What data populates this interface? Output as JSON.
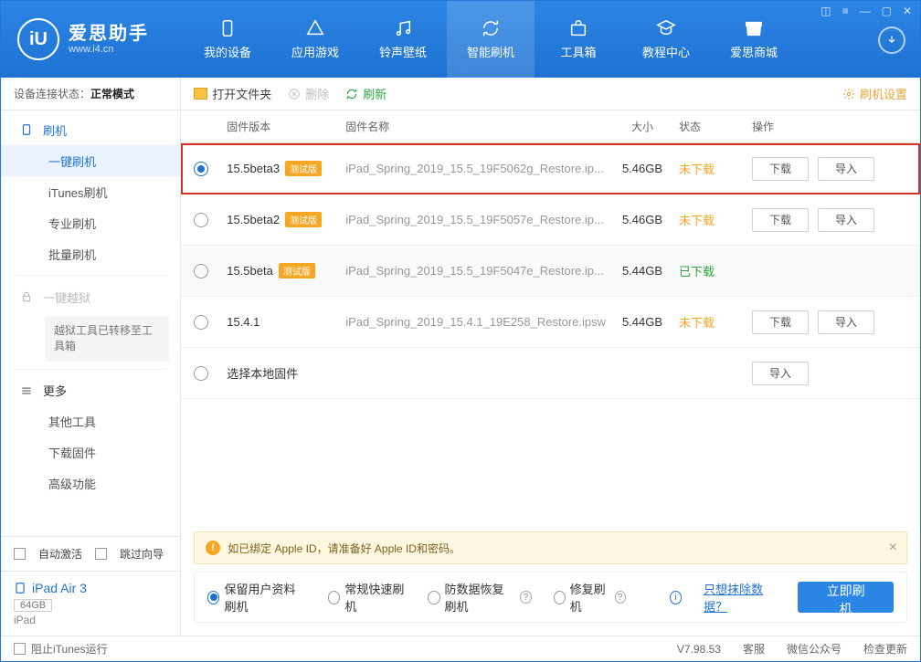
{
  "app": {
    "name": "爱思助手",
    "url": "www.i4.cn"
  },
  "nav": {
    "items": [
      {
        "id": "device",
        "label": "我的设备"
      },
      {
        "id": "apps",
        "label": "应用游戏"
      },
      {
        "id": "ring",
        "label": "铃声壁纸"
      },
      {
        "id": "flash",
        "label": "智能刷机"
      },
      {
        "id": "tools",
        "label": "工具箱"
      },
      {
        "id": "tutorial",
        "label": "教程中心"
      },
      {
        "id": "store",
        "label": "爱思商城"
      }
    ],
    "active": 3
  },
  "connection": {
    "label": "设备连接状态：",
    "value": "正常模式"
  },
  "sidebar": {
    "flash": {
      "label": "刷机",
      "children": [
        {
          "id": "oneclick",
          "label": "一键刷机"
        },
        {
          "id": "itunes",
          "label": "iTunes刷机"
        },
        {
          "id": "pro",
          "label": "专业刷机"
        },
        {
          "id": "batch",
          "label": "批量刷机"
        }
      ]
    },
    "jailbreak": {
      "label": "一键越狱",
      "note": "越狱工具已转移至工具箱"
    },
    "more": {
      "label": "更多",
      "children": [
        {
          "id": "othertools",
          "label": "其他工具"
        },
        {
          "id": "downloadfw",
          "label": "下载固件"
        },
        {
          "id": "advanced",
          "label": "高级功能"
        }
      ]
    }
  },
  "sideFooter": {
    "autoActivate": "自动激活",
    "skipGuide": "跳过向导"
  },
  "device": {
    "name": "iPad Air 3",
    "capacity": "64GB",
    "type": "iPad"
  },
  "toolbar": {
    "open": "打开文件夹",
    "delete": "删除",
    "refresh": "刷新",
    "settings": "刷机设置"
  },
  "columns": {
    "version": "固件版本",
    "name": "固件名称",
    "size": "大小",
    "status": "状态",
    "ops": "操作"
  },
  "statusLabels": {
    "not": "未下载",
    "done": "已下载"
  },
  "opsLabels": {
    "download": "下载",
    "import": "导入"
  },
  "firmware": [
    {
      "version": "15.5beta3",
      "beta": true,
      "name": "iPad_Spring_2019_15.5_19F5062g_Restore.ip...",
      "size": "5.46GB",
      "status": "not",
      "selected": true,
      "highlight": true,
      "showDownload": true
    },
    {
      "version": "15.5beta2",
      "beta": true,
      "name": "iPad_Spring_2019_15.5_19F5057e_Restore.ip...",
      "size": "5.46GB",
      "status": "not",
      "selected": false,
      "showDownload": true
    },
    {
      "version": "15.5beta",
      "beta": true,
      "name": "iPad_Spring_2019_15.5_19F5047e_Restore.ip...",
      "size": "5.44GB",
      "status": "done",
      "selected": false,
      "alt": true,
      "showDownload": false
    },
    {
      "version": "15.4.1",
      "beta": false,
      "name": "iPad_Spring_2019_15.4.1_19E258_Restore.ipsw",
      "size": "5.44GB",
      "status": "not",
      "selected": false,
      "showDownload": true
    }
  ],
  "localRow": {
    "label": "选择本地固件",
    "import": "导入"
  },
  "betaTag": "测试版",
  "notice": {
    "text": "如已绑定 Apple ID，请准备好 Apple ID和密码。"
  },
  "modes": {
    "items": [
      {
        "id": "keep",
        "label": "保留用户资料刷机",
        "q": false
      },
      {
        "id": "normal",
        "label": "常规快速刷机",
        "q": false
      },
      {
        "id": "anti",
        "label": "防数据恢复刷机",
        "q": true
      },
      {
        "id": "repair",
        "label": "修复刷机",
        "q": true
      }
    ],
    "selected": 0,
    "eraseLink": "只想抹除数据？",
    "flashBtn": "立即刷机"
  },
  "statusbar": {
    "blockItunes": "阻止iTunes运行",
    "version": "V7.98.53",
    "support": "客服",
    "wechat": "微信公众号",
    "update": "检查更新"
  }
}
